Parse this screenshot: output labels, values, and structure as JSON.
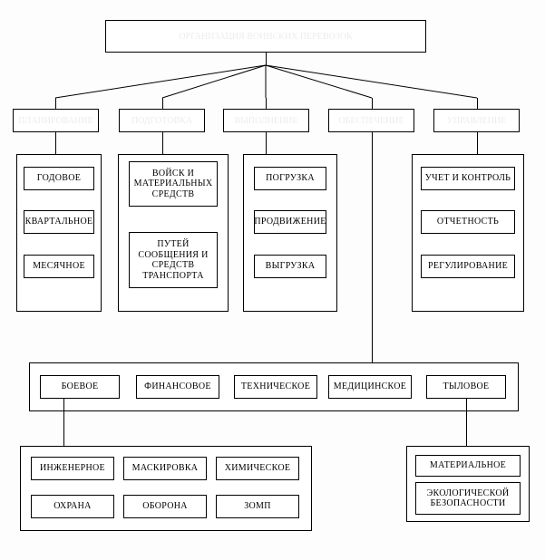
{
  "chart_data": {
    "type": "diagram",
    "title": "ОРГАНИЗАЦИЯ ВОИНСКИХ ПЕРЕВОЗОК",
    "top_categories": [
      "ПЛАНИРОВАНИЕ",
      "ПОДГОТОВКА",
      "ВЫПОЛНЕНИЕ",
      "ОБЕСПЕЧЕНИЕ",
      "УПРАВЛЕНИЕ"
    ],
    "columns": {
      "planning": [
        "ГОДОВОЕ",
        "КВАРТАЛЬНОЕ",
        "МЕСЯЧНОЕ"
      ],
      "preparation": [
        "ВОЙСК И МАТЕРИАЛЬНЫХ СРЕДСТВ",
        "ПУТЕЙ СООБЩЕНИЯ И СРЕДСТВ ТРАНСПОРТА"
      ],
      "execution": [
        "ПОГРУЗКА",
        "ПРОДВИЖЕНИЕ",
        "ВЫГРУЗКА"
      ],
      "management": [
        "УЧЕТ И КОНТРОЛЬ",
        "ОТЧЕТНОСТЬ",
        "РЕГУЛИРОВАНИЕ"
      ]
    },
    "support_row": [
      "БОЕВОЕ",
      "ФИНАНСОВОЕ",
      "ТЕХНИЧЕСКОЕ",
      "МЕДИЦИНСКОЕ",
      "ТЫЛОВОЕ"
    ],
    "combat_detail": [
      "ИНЖЕНЕРНОЕ",
      "МАСКИРОВКА",
      "ХИМИЧЕСКОЕ",
      "ОХРАНА",
      "ОБОРОНА",
      "ЗОМП"
    ],
    "rear_detail": [
      "МАТЕРИАЛЬНОЕ",
      "ЭКОЛОГИЧЕСКОЙ БЕЗОПАСНОСТИ"
    ]
  },
  "root": "ОРГАНИЗАЦИЯ ВОИНСКИХ ПЕРЕВОЗОК",
  "cats": {
    "c1": "ПЛАНИРОВАНИЕ",
    "c2": "ПОДГОТОВКА",
    "c3": "ВЫПОЛНЕНИЕ",
    "c4": "ОБЕСПЕЧЕНИЕ",
    "c5": "УПРАВЛЕНИЕ"
  },
  "col1": {
    "a": "ГОДОВОЕ",
    "b": "КВАРТАЛЬНОЕ",
    "c": "МЕСЯЧНОЕ"
  },
  "col2": {
    "a": "ВОЙСК И МАТЕРИАЛЬНЫХ СРЕДСТВ",
    "b": "ПУТЕЙ СООБЩЕНИЯ И СРЕДСТВ ТРАНСПОРТА"
  },
  "col3": {
    "a": "ПОГРУЗКА",
    "b": "ПРОДВИЖЕНИЕ",
    "c": "ВЫГРУЗКА"
  },
  "col5": {
    "a": "УЧЕТ И КОНТРОЛЬ",
    "b": "ОТЧЕТНОСТЬ",
    "c": "РЕГУЛИРОВАНИЕ"
  },
  "row2": {
    "a": "БОЕВОЕ",
    "b": "ФИНАНСОВОЕ",
    "c": "ТЕХНИЧЕСКОЕ",
    "d": "МЕДИЦИНСКОЕ",
    "e": "ТЫЛОВОЕ"
  },
  "row3": {
    "a": "ИНЖЕНЕРНОЕ",
    "b": "МАСКИРОВКА",
    "c": "ХИМИЧЕСКОЕ",
    "d": "ОХРАНА",
    "e": "ОБОРОНА",
    "f": "ЗОМП"
  },
  "row4": {
    "a": "МАТЕРИАЛЬНОЕ",
    "b": "ЭКОЛОГИЧЕСКОЙ БЕЗОПАСНОСТИ"
  }
}
